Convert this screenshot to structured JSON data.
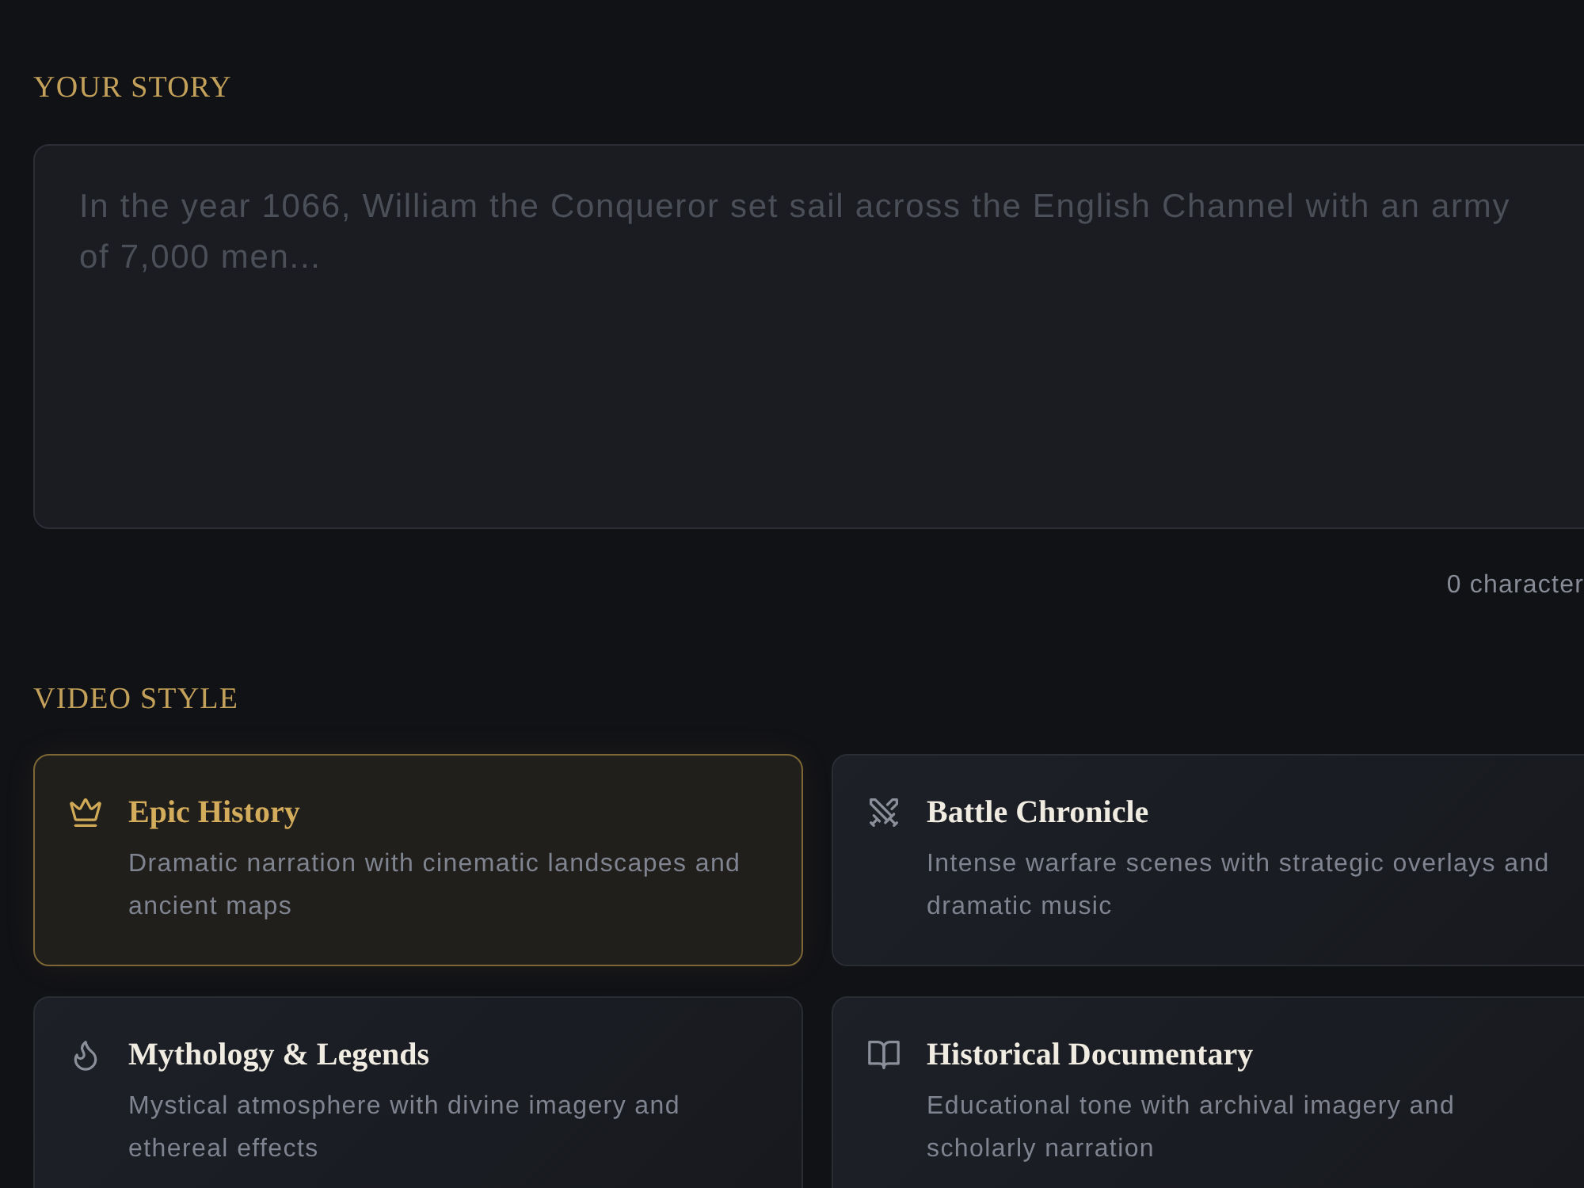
{
  "story": {
    "label": "YOUR STORY",
    "placeholder": "In the year 1066, William the Conqueror set sail across the English Channel with an army of 7,000 men...",
    "counter": "0 character"
  },
  "video_style": {
    "label": "VIDEO STYLE",
    "options": [
      {
        "kind": "crown",
        "title": "Epic History",
        "description": "Dramatic narration with cinematic landscapes and ancient maps",
        "selected": true
      },
      {
        "kind": "swords",
        "title": "Battle Chronicle",
        "description": "Intense warfare scenes with strategic overlays and dramatic music",
        "selected": false
      },
      {
        "kind": "flame",
        "title": "Mythology & Legends",
        "description": "Mystical atmosphere with divine imagery and ethereal effects",
        "selected": false
      },
      {
        "kind": "book",
        "title": "Historical Documentary",
        "description": "Educational tone with archival imagery and scholarly narration",
        "selected": false
      }
    ]
  }
}
